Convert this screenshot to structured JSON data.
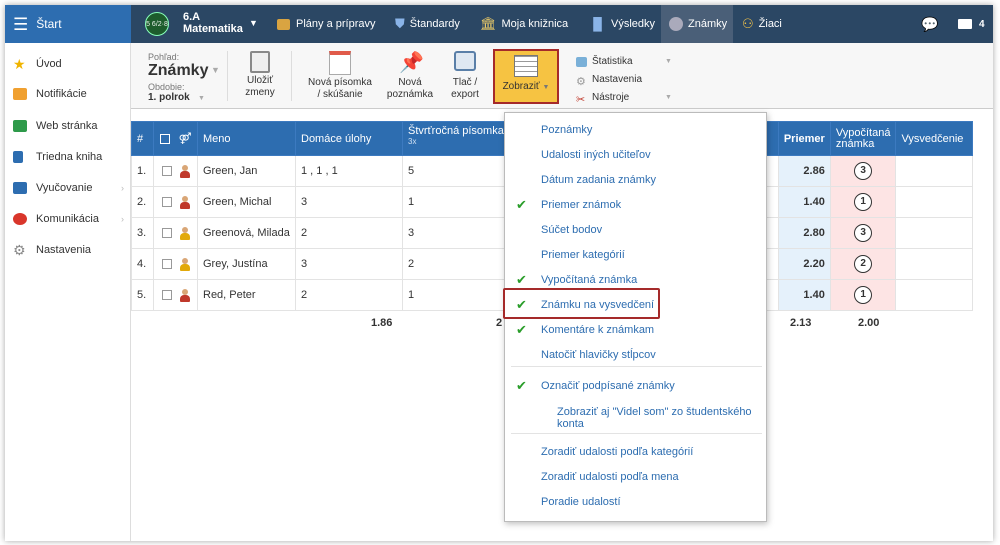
{
  "topbar": {
    "start_label": "Štart",
    "class_badge": "5 6/2·8",
    "class_name": "6.A",
    "class_subject": "Matematika",
    "nav": [
      {
        "label": "Plány a prípravy",
        "icon": "briefcase-icon"
      },
      {
        "label": "Štandardy",
        "icon": "shield-icon"
      },
      {
        "label": "Moja knižnica",
        "icon": "library-icon"
      },
      {
        "label": "Výsledky",
        "icon": "bar-chart-icon"
      },
      {
        "label": "Známky",
        "icon": "grades-icon"
      },
      {
        "label": "Žiaci",
        "icon": "students-icon"
      }
    ],
    "messages_count": "4"
  },
  "sidebar": {
    "items": [
      {
        "label": "Úvod",
        "icon": "star-icon"
      },
      {
        "label": "Notifikácie",
        "icon": "envelope-icon"
      },
      {
        "label": "Web stránka",
        "icon": "home-icon"
      },
      {
        "label": "Triedna kniha",
        "icon": "book-icon"
      },
      {
        "label": "Vyučovanie",
        "icon": "open-book-icon"
      },
      {
        "label": "Komunikácia",
        "icon": "chat-icon"
      },
      {
        "label": "Nastavenia",
        "icon": "gear-icon"
      }
    ]
  },
  "toolbar": {
    "view_label": "Pohľad:",
    "view_value": "Známky",
    "period_label": "Obdobie:",
    "period_value": "1. polrok",
    "save_line1": "Uložiť",
    "save_line2": "zmeny",
    "new_test_line1": "Nová písomka",
    "new_test_line2": "/ skúšanie",
    "new_note_line1": "Nová",
    "new_note_line2": "poznámka",
    "print_line1": "Tlač /",
    "print_line2": "export",
    "show_label": "Zobraziť",
    "stats_label": "Štatistika",
    "settings_label": "Nastavenia",
    "tools_label": "Nástroje"
  },
  "table": {
    "headers": {
      "num": "#",
      "name": "Meno",
      "homework": "Domáce úlohy",
      "quarter": "Štvrťročná písomka",
      "quarter_sub": "3x",
      "average": "Priemer",
      "computed_line1": "Vypočítaná",
      "computed_line2": "známka",
      "report": "Vysvedčenie"
    },
    "rows": [
      {
        "num": "1.",
        "name": "Green, Jan",
        "homework": "1 , 1 , 1",
        "quarter": "5",
        "avg": "2.86",
        "grade": "3"
      },
      {
        "num": "2.",
        "name": "Green, Michal",
        "homework": "3",
        "quarter": "1",
        "avg": "1.40",
        "grade": "1"
      },
      {
        "num": "3.",
        "name": "Greenová, Milada",
        "homework": "2",
        "quarter": "3",
        "avg": "2.80",
        "grade": "3"
      },
      {
        "num": "4.",
        "name": "Grey, Justína",
        "homework": "3",
        "quarter": "2",
        "avg": "2.20",
        "grade": "2"
      },
      {
        "num": "5.",
        "name": "Red, Peter",
        "homework": "2",
        "quarter": "1",
        "avg": "1.40",
        "grade": "1"
      }
    ],
    "footer": {
      "homework_avg": "1.86",
      "quarter_avg_partial": "2",
      "avg_total": "2.13",
      "grade_total": "2.00"
    }
  },
  "dropdown": {
    "items": [
      {
        "label": "Poznámky",
        "checked": false
      },
      {
        "label": "Udalosti iných učiteľov",
        "checked": false
      },
      {
        "label": "Dátum zadania známky",
        "checked": false
      },
      {
        "label": "Priemer známok",
        "checked": true
      },
      {
        "label": "Súčet bodov",
        "checked": false
      },
      {
        "label": "Priemer kategórií",
        "checked": false
      },
      {
        "label": "Vypočítaná známka",
        "checked": true
      },
      {
        "label": "Známku na vysvedčení",
        "checked": true
      },
      {
        "label": "Komentáre k známkam",
        "checked": true
      },
      {
        "label": "Natočiť hlavičky stĺpcov",
        "checked": false
      },
      {
        "label": "Označiť podpísané známky",
        "checked": true
      },
      {
        "label": "Zobraziť aj \"Videl som\" zo študentského konta",
        "checked": false
      },
      {
        "label": "Zoradiť udalosti podľa kategórií",
        "checked": false
      },
      {
        "label": "Zoradiť udalosti podľa mena",
        "checked": false
      },
      {
        "label": "Poradie udalostí",
        "checked": false
      }
    ]
  },
  "colors": {
    "topbar": "#2b4764",
    "accent_blue": "#2d6db0",
    "highlight": "#f6c342",
    "outline_red": "#a52a2a",
    "check_green": "#2a9d2a"
  }
}
